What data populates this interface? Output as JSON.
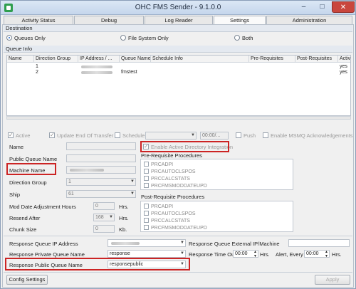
{
  "window": {
    "title": "OHC FMS Sender - 9.1.0.0",
    "controls": {
      "minimize": "–",
      "maximize": "□",
      "close": "✕"
    },
    "icon": "app-icon"
  },
  "tabs": [
    {
      "label": "Activity Status",
      "active": false
    },
    {
      "label": "Debug",
      "active": false
    },
    {
      "label": "Log Reader",
      "active": false
    },
    {
      "label": "Settings",
      "active": true
    },
    {
      "label": "Administration",
      "active": false
    }
  ],
  "destination": {
    "section_label": "Destination",
    "options": [
      {
        "label": "Queues Only",
        "checked": true
      },
      {
        "label": "File System Only",
        "checked": false
      },
      {
        "label": "Both",
        "checked": false
      }
    ]
  },
  "queue_info": {
    "section_label": "Queue Info",
    "columns": [
      "Name",
      "Direction Group",
      "IP Address / ...",
      "Queue Name",
      "Schedule Info",
      "Pre-Requisites",
      "Post-Requisites",
      "Activ"
    ],
    "rows": [
      {
        "direction_group": "1",
        "queue_name": "",
        "active": "yes"
      },
      {
        "direction_group": "2",
        "queue_name": "fmstest",
        "active": "yes"
      }
    ]
  },
  "options_row": {
    "active": "Active",
    "update_end_of_transfer": "Update End Of Transfer",
    "schedule": "Schedule",
    "time_value": "00:00/...",
    "push": "Push",
    "enable_msmq_ack": "Enable MSMQ Acknowledgements",
    "enable_ad_integration": "Enable Active Directory Integration"
  },
  "form": {
    "name_label": "Name",
    "public_queue_name_label": "Public Queue Name",
    "machine_name_label": "Machine Name",
    "direction_group_label": "Direction Group",
    "direction_group_value": "1",
    "ship_label": "Ship",
    "ship_value": "61",
    "mod_date_label": "Mod Date Adjustment Hours",
    "mod_date_value": "0",
    "mod_date_unit": "Hrs.",
    "resend_after_label": "Resend After",
    "resend_after_value": "168",
    "resend_after_unit": "Hrs.",
    "chunk_size_label": "Chunk Size",
    "chunk_size_value": "0",
    "chunk_size_unit": "Kb."
  },
  "pre_requisite": {
    "label": "Pre-Requisite Procedures",
    "items": [
      "PRCADPI",
      "PRCAUTOCLSPOS",
      "PRCCALCSTATS",
      "PRCFMSMODDATEUPD"
    ]
  },
  "post_requisite": {
    "label": "Post-Requisite Procedures",
    "items": [
      "PRCADPI",
      "PRCAUTOCLSPOS",
      "PRCCALCSTATS",
      "PRCFMSMODDATEUPD"
    ]
  },
  "response": {
    "ip_label": "Response Queue IP Address",
    "external_ip_label": "Response Queue External IP/Machine",
    "private_label": "Response Private Queue Name",
    "private_value": "response",
    "timeout_label": "Response Time Out",
    "timeout_value": "00:00",
    "timeout_unit": "Hrs.",
    "alert_label": "Alert, Every",
    "alert_value": "00:00",
    "alert_unit": "Hrs.",
    "public_label": "Response Public Queue Name",
    "public_value": "responsepublic"
  },
  "footer": {
    "config_button": "Config Settings",
    "apply_button": "Apply"
  },
  "colors": {
    "highlight": "#cc2424",
    "accent": "#1f63c6"
  }
}
